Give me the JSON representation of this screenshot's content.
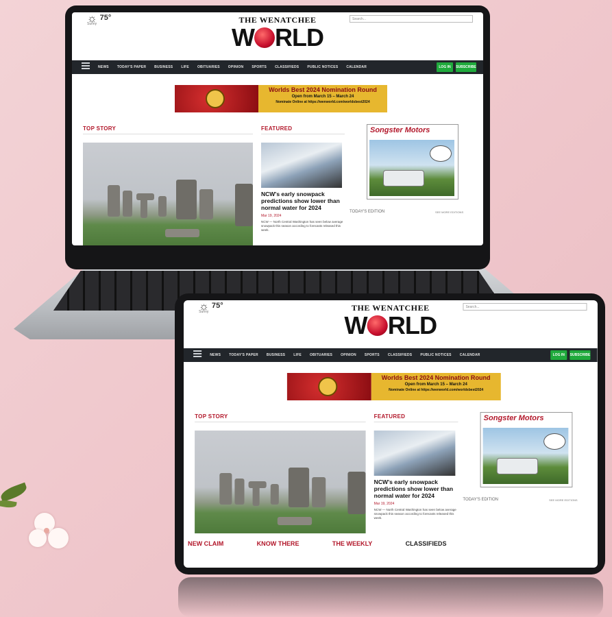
{
  "weather": {
    "temp": "75°",
    "condition": "Sunny"
  },
  "logo": {
    "top": "THE WENATCHEE",
    "main_pre": "W",
    "main_post": "RLD"
  },
  "search": {
    "placeholder": "Search..."
  },
  "nav": {
    "items": [
      "NEWS",
      "TODAY'S PAPER",
      "BUSINESS",
      "LIFE",
      "OBITUARIES",
      "OPINION",
      "SPORTS",
      "CLASSIFIEDS",
      "PUBLIC NOTICES",
      "CALENDAR"
    ],
    "login": "LOG IN",
    "subscribe": "SUBSCRIBE",
    "menu_label": "MENU"
  },
  "banner": {
    "title": "Worlds Best 2024 Nomination Round",
    "dates": "Open from March 15 – March 24",
    "url": "Nominate Online at https://wenworld.com/worldsbest2024"
  },
  "sections": {
    "top_story": "TOP STORY",
    "featured": "FEATURED"
  },
  "featured": {
    "headline": "NCW's early snowpack predictions show lower than normal water for 2024",
    "date": "Mar 19, 2024",
    "body": "NCW — North Central Washington has seen below average snowpack this season according to forecasts released this week."
  },
  "ad": {
    "title": "Songster Motors"
  },
  "edition": {
    "label": "TODAY'S EDITION",
    "link": "SEE MORE EDITIONS"
  },
  "categories": [
    "NEW CLAIM",
    "KNOW THERE",
    "THE WEEKLY",
    "CLASSIFIEDS"
  ],
  "colors": {
    "accent": "#b2172a",
    "nav_bg": "#22262b",
    "button": "#1faa3c",
    "banner_gold": "#e7b72f"
  }
}
